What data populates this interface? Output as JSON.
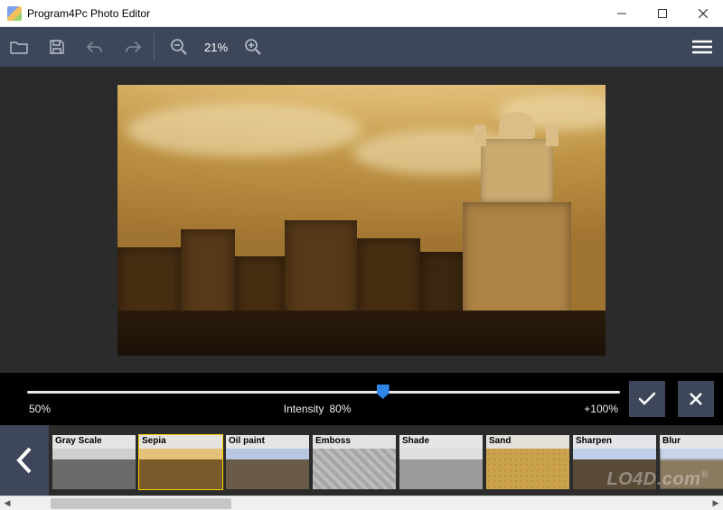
{
  "window": {
    "title": "Program4Pc Photo Editor"
  },
  "toolbar": {
    "zoom_level": "21%"
  },
  "intensity": {
    "min_label": "50%",
    "name": "Intensity",
    "value_label": "80%",
    "max_label": "+100%",
    "slider_percent": 60
  },
  "filters": {
    "selected_index": 1,
    "items": [
      {
        "label": "Gray Scale",
        "style": "ti-gray"
      },
      {
        "label": "Sepia",
        "style": "ti-sepia"
      },
      {
        "label": "Oil paint",
        "style": "ti-oil"
      },
      {
        "label": "Emboss",
        "style": "ti-emboss"
      },
      {
        "label": "Shade",
        "style": "ti-shade"
      },
      {
        "label": "Sand",
        "style": "ti-sand"
      },
      {
        "label": "Sharpen",
        "style": "ti-sharpen"
      },
      {
        "label": "Blur",
        "style": "ti-blur"
      }
    ]
  },
  "watermark": "LO4D.com"
}
